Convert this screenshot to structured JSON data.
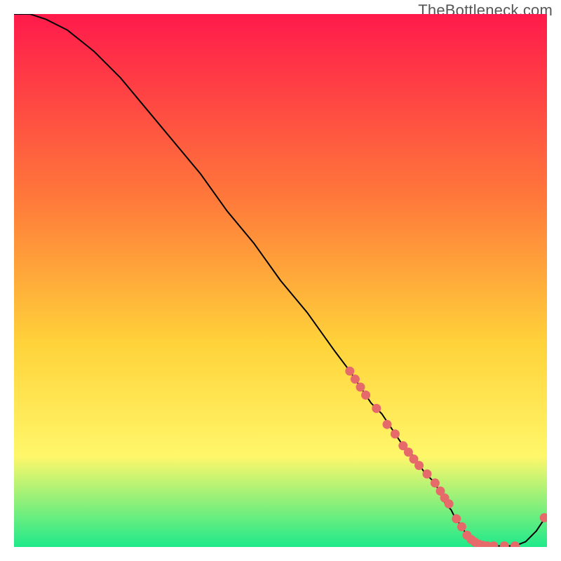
{
  "watermark": "TheBottleneck.com",
  "colors": {
    "gradient_top": "#ff1a4b",
    "gradient_mid1": "#ff7a3a",
    "gradient_mid2": "#ffd33a",
    "gradient_mid3": "#fff76a",
    "gradient_bottom": "#1fe98a",
    "curve": "#000000",
    "marker": "#e66a6a"
  },
  "chart_data": {
    "type": "line",
    "title": "",
    "xlabel": "",
    "ylabel": "",
    "xlim": [
      0,
      100
    ],
    "ylim": [
      0,
      100
    ],
    "grid": false,
    "legend": false,
    "series": [
      {
        "name": "curve",
        "x": [
          0,
          3,
          6,
          10,
          15,
          20,
          25,
          30,
          35,
          40,
          45,
          50,
          55,
          60,
          63,
          65,
          67,
          69,
          71,
          73,
          75,
          77,
          79,
          81,
          82,
          83,
          84,
          85,
          86,
          87,
          88,
          89,
          90,
          92,
          94,
          96,
          98,
          100
        ],
        "y": [
          100,
          100,
          99,
          97,
          93,
          88,
          82,
          76,
          70,
          63,
          57,
          50,
          44,
          37,
          33,
          30,
          27,
          25,
          22,
          19,
          17,
          14,
          12,
          8,
          7,
          5,
          4,
          2,
          1,
          0.5,
          0.3,
          0.2,
          0.2,
          0.2,
          0.2,
          1,
          3,
          6
        ]
      },
      {
        "name": "markers",
        "x": [
          63,
          64,
          65,
          66,
          68,
          70,
          71.5,
          73,
          74,
          75,
          76,
          77.5,
          79,
          80,
          80.8,
          81.6,
          83,
          84,
          85,
          85.8,
          86.5,
          87.3,
          88,
          88.8,
          90,
          92,
          94,
          99.5
        ],
        "y": [
          33,
          31.5,
          30,
          28.5,
          26,
          23,
          21.2,
          19,
          17.8,
          16.5,
          15.3,
          13.7,
          12,
          10.5,
          9.2,
          8.1,
          5.3,
          3.8,
          2.2,
          1.4,
          0.9,
          0.5,
          0.3,
          0.2,
          0.2,
          0.2,
          0.2,
          5.5
        ]
      }
    ]
  }
}
